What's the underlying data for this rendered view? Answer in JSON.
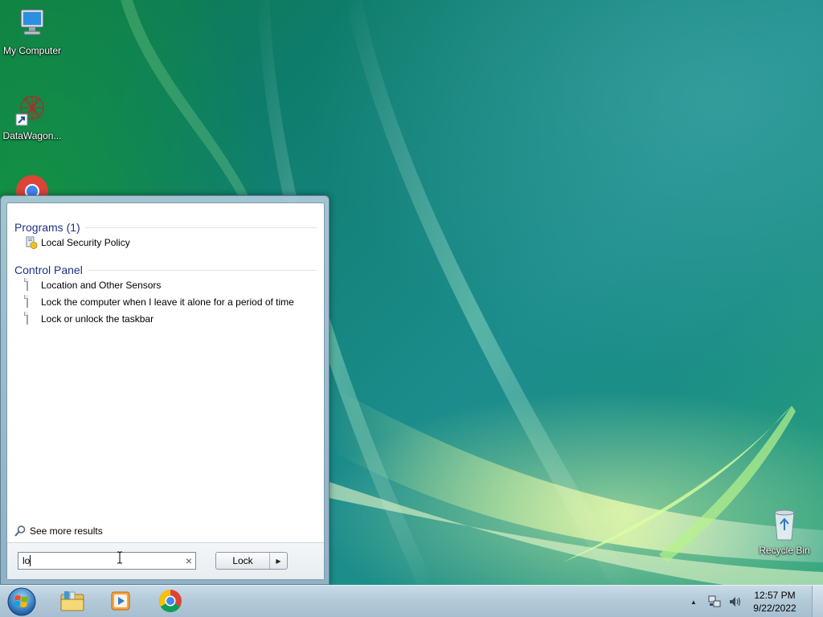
{
  "desktop": {
    "icons": [
      {
        "label": "My Computer",
        "icon": "computer-icon"
      },
      {
        "label": "DataWagon...",
        "icon": "datawagon-shortcut-icon"
      },
      {
        "label": "",
        "icon": "chrome-icon"
      },
      {
        "label": "Recycle Bin",
        "icon": "recycle-bin-icon"
      }
    ]
  },
  "start_menu": {
    "programs_heading": "Programs (1)",
    "programs": [
      {
        "label": "Local Security Policy",
        "icon": "security-policy-icon"
      }
    ],
    "control_panel_heading": "Control Panel",
    "control_panel": [
      {
        "label": "Location and Other Sensors",
        "icon": "document-icon"
      },
      {
        "label": "Lock the computer when I leave it alone for a period of time",
        "icon": "document-icon"
      },
      {
        "label": "Lock or unlock the taskbar",
        "icon": "document-icon"
      }
    ],
    "see_more": "See more results",
    "search": {
      "value": "lo",
      "clear_icon": "clear-icon"
    },
    "power_button": {
      "label": "Lock",
      "arrow_icon": "arrow-right-icon"
    }
  },
  "taskbar": {
    "start_icon": "windows-start-orb-icon",
    "pinned": [
      {
        "name": "file-explorer",
        "icon": "folder-library-icon"
      },
      {
        "name": "media-player",
        "icon": "media-player-icon"
      },
      {
        "name": "chrome",
        "icon": "chrome-icon"
      }
    ],
    "tray": {
      "time": "12:57 PM",
      "date": "9/22/2022",
      "icons": [
        "show-hidden-icons-arrow",
        "network-icon",
        "volume-icon"
      ]
    }
  }
}
